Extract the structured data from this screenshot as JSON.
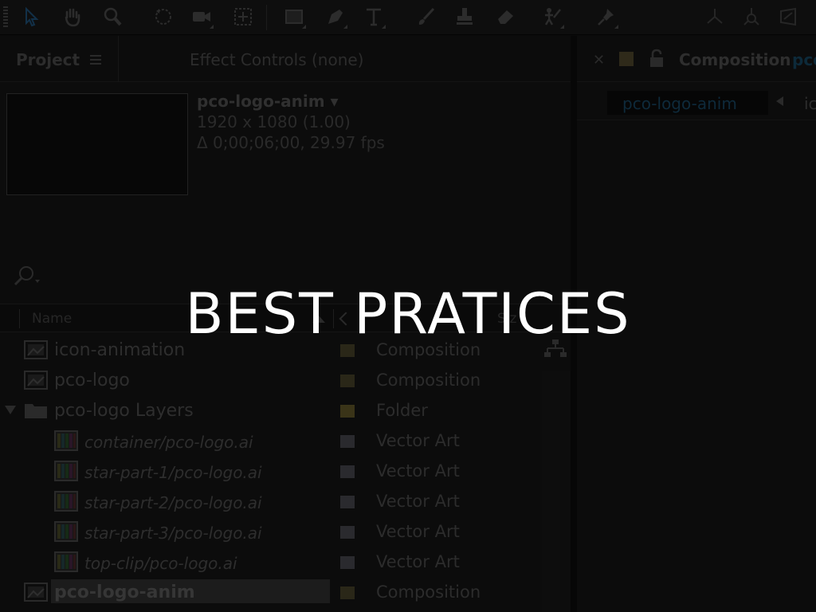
{
  "toolbar": {
    "tools": [
      "selection-tool-icon",
      "hand-tool-icon",
      "zoom-tool-icon",
      "rotate-tool-icon",
      "camera-tool-icon",
      "pan-behind-tool-icon",
      "rectangle-tool-icon",
      "pen-tool-icon",
      "type-tool-icon",
      "brush-tool-icon",
      "clone-stamp-tool-icon",
      "eraser-tool-icon",
      "roto-brush-tool-icon",
      "puppet-pin-tool-icon"
    ]
  },
  "project_panel": {
    "tab_label": "Project",
    "effect_controls_label": "Effect Controls (none)",
    "comp_name": "pco-logo-anim ▾",
    "resolution": "1920 x 1080 (1.00)",
    "duration": "Δ 0;00;06;00, 29.97 fps",
    "columns": {
      "name": "Name",
      "size": "Siz"
    },
    "items": [
      {
        "name": "icon-animation",
        "type": "Composition",
        "icon": "composition-icon",
        "label_color": "#2a2718",
        "style": "normal",
        "indent": 0
      },
      {
        "name": "pco-logo",
        "type": "Composition",
        "icon": "composition-icon",
        "label_color": "#2a2718",
        "style": "normal",
        "indent": 0
      },
      {
        "name": "pco-logo Layers",
        "type": "Folder",
        "icon": "folder-icon",
        "label_color": "#3a3418",
        "style": "normal",
        "indent": 0,
        "expanded": true
      },
      {
        "name": "container/pco-logo.ai",
        "type": "Vector Art",
        "icon": "vector-art-icon",
        "label_color": "#2a2a2e",
        "style": "italic",
        "indent": 1
      },
      {
        "name": "star-part-1/pco-logo.ai",
        "type": "Vector Art",
        "icon": "vector-art-icon",
        "label_color": "#2a2a2e",
        "style": "italic",
        "indent": 1
      },
      {
        "name": "star-part-2/pco-logo.ai",
        "type": "Vector Art",
        "icon": "vector-art-icon",
        "label_color": "#2a2a2e",
        "style": "italic",
        "indent": 1
      },
      {
        "name": "star-part-3/pco-logo.ai",
        "type": "Vector Art",
        "icon": "vector-art-icon",
        "label_color": "#2a2a2e",
        "style": "italic",
        "indent": 1
      },
      {
        "name": "top-clip/pco-logo.ai",
        "type": "Vector Art",
        "icon": "vector-art-icon",
        "label_color": "#2a2a2e",
        "style": "italic",
        "indent": 1
      },
      {
        "name": "pco-logo-anim",
        "type": "Composition",
        "icon": "composition-icon",
        "label_color": "#2a2718",
        "style": "bold",
        "indent": 0,
        "selected": true
      }
    ]
  },
  "composition_panel": {
    "tab_title": "Composition",
    "tab_title_suffix": "pco",
    "breadcrumb_active": "pco-logo-anim",
    "breadcrumb_next": "ic"
  },
  "overlay": {
    "headline": "BEST PRATICES"
  }
}
